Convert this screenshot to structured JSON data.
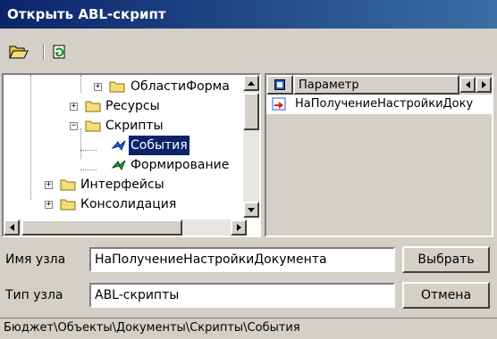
{
  "window": {
    "title": "Открыть ABL-скрипт"
  },
  "toolbar": {
    "open_icon": "open-folder-icon",
    "refresh_icon": "refresh-icon"
  },
  "tree": {
    "items": [
      {
        "label": "ОбластиФорма",
        "icon": "folder-icon",
        "expander": "+"
      },
      {
        "label": "Ресурсы",
        "icon": "folder-icon",
        "expander": "+"
      },
      {
        "label": "Скрипты",
        "icon": "folder-icon",
        "expander": "−"
      },
      {
        "label": "События",
        "icon": "script-icon",
        "selected": true
      },
      {
        "label": "Формирование",
        "icon": "script-icon"
      },
      {
        "label": "Интерфейсы",
        "icon": "folder-icon",
        "expander": "+"
      },
      {
        "label": "Консолидация",
        "icon": "folder-icon",
        "expander": "+"
      }
    ]
  },
  "grid": {
    "header": {
      "column": "Параметр"
    },
    "rows": [
      {
        "value": "НаПолучениеНастройкиДоку"
      }
    ]
  },
  "form": {
    "node_name_label": "Имя узла",
    "node_name_value": "НаПолучениеНастройкиДокумента",
    "node_type_label": "Тип узла",
    "node_type_value": "ABL-скрипты"
  },
  "buttons": {
    "select": "Выбрать",
    "cancel": "Отмена"
  },
  "status": {
    "path": "Бюджет\\Объекты\\Документы\\Скрипты\\События"
  },
  "colors": {
    "selection": "#0a246a",
    "title_start": "#0a246a",
    "title_end": "#3a6ea5",
    "face": "#d4d0c8"
  }
}
